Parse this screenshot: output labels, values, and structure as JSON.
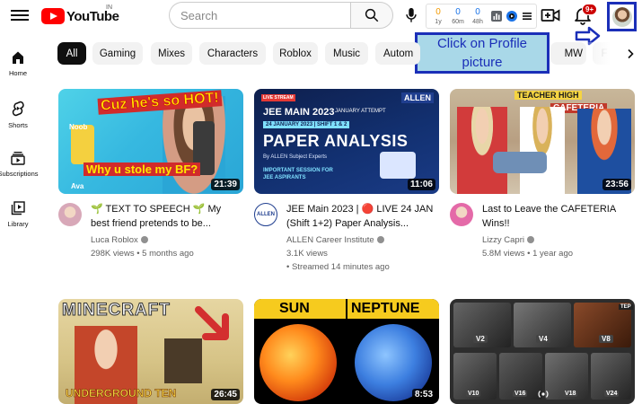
{
  "header": {
    "logo_text": "YouTube",
    "country_code": "IN",
    "search_placeholder": "Search",
    "notification_count": "9+",
    "extension_stats": [
      {
        "value": "0",
        "label": "1y",
        "color": "orange"
      },
      {
        "value": "0",
        "label": "60m",
        "color": "blue"
      },
      {
        "value": "0",
        "label": "48h",
        "color": "blue"
      }
    ]
  },
  "annotation": {
    "text": "Click on Profile picture"
  },
  "sidebar": {
    "items": [
      {
        "label": "Home",
        "icon": "home-icon"
      },
      {
        "label": "Shorts",
        "icon": "shorts-icon"
      },
      {
        "label": "Subscriptions",
        "icon": "subscriptions-icon"
      },
      {
        "label": "Library",
        "icon": "library-icon"
      }
    ]
  },
  "chips": [
    "All",
    "Gaming",
    "Mixes",
    "Characters",
    "Roblox",
    "Music",
    "Autom",
    "MW",
    "F"
  ],
  "videos": [
    {
      "title": "🌱 TEXT TO SPEECH 🌱 My best friend pretends to be...",
      "channel": "Luca Roblox",
      "views": "298K views • 5 months ago",
      "extra": "",
      "duration": "21:39",
      "thumb_texts": [
        "Cuz he's so HOT!",
        "Why u stole my BF?",
        "Noob",
        "Ava"
      ]
    },
    {
      "title": "JEE Main 2023 | 🔴 LIVE 24 JAN (Shift 1+2) Paper Analysis...",
      "channel": "ALLEN Career Institute",
      "views": "3.1K views",
      "extra": "• Streamed 14 minutes ago",
      "duration": "11:06",
      "thumb_texts": [
        "LIVE STREAM",
        "ALLEN",
        "JEE MAIN 2023",
        "JANUARY ATTEMPT",
        "24 JANUARY 2023 | SHIFT 1 & 2",
        "PAPER ANALYSIS",
        "By ALLEN Subject Experts",
        "IMPORTANT SESSION FOR",
        "JEE ASPIRANTS"
      ]
    },
    {
      "title": "Last to Leave the CAFETERIA Wins!!",
      "channel": "Lizzy Capri",
      "views": "5.8M views • 1 year ago",
      "extra": "",
      "duration": "23:56",
      "thumb_texts": [
        "TEACHER HIGH",
        "CAFETERIA"
      ]
    },
    {
      "title": "",
      "channel": "",
      "views": "",
      "extra": "",
      "duration": "26:45",
      "thumb_texts": [
        "MINECRAFT",
        "UNDERGROUND TEN"
      ]
    },
    {
      "title": "",
      "channel": "",
      "views": "",
      "extra": "",
      "duration": "8:53",
      "thumb_texts": [
        "SUN",
        "NEPTUNE"
      ]
    },
    {
      "title": "",
      "channel": "",
      "views": "",
      "extra": "",
      "duration": "",
      "thumb_texts": [
        "V2",
        "V4",
        "V8",
        "V10",
        "V16",
        "V18",
        "V24",
        "TEP"
      ]
    }
  ]
}
